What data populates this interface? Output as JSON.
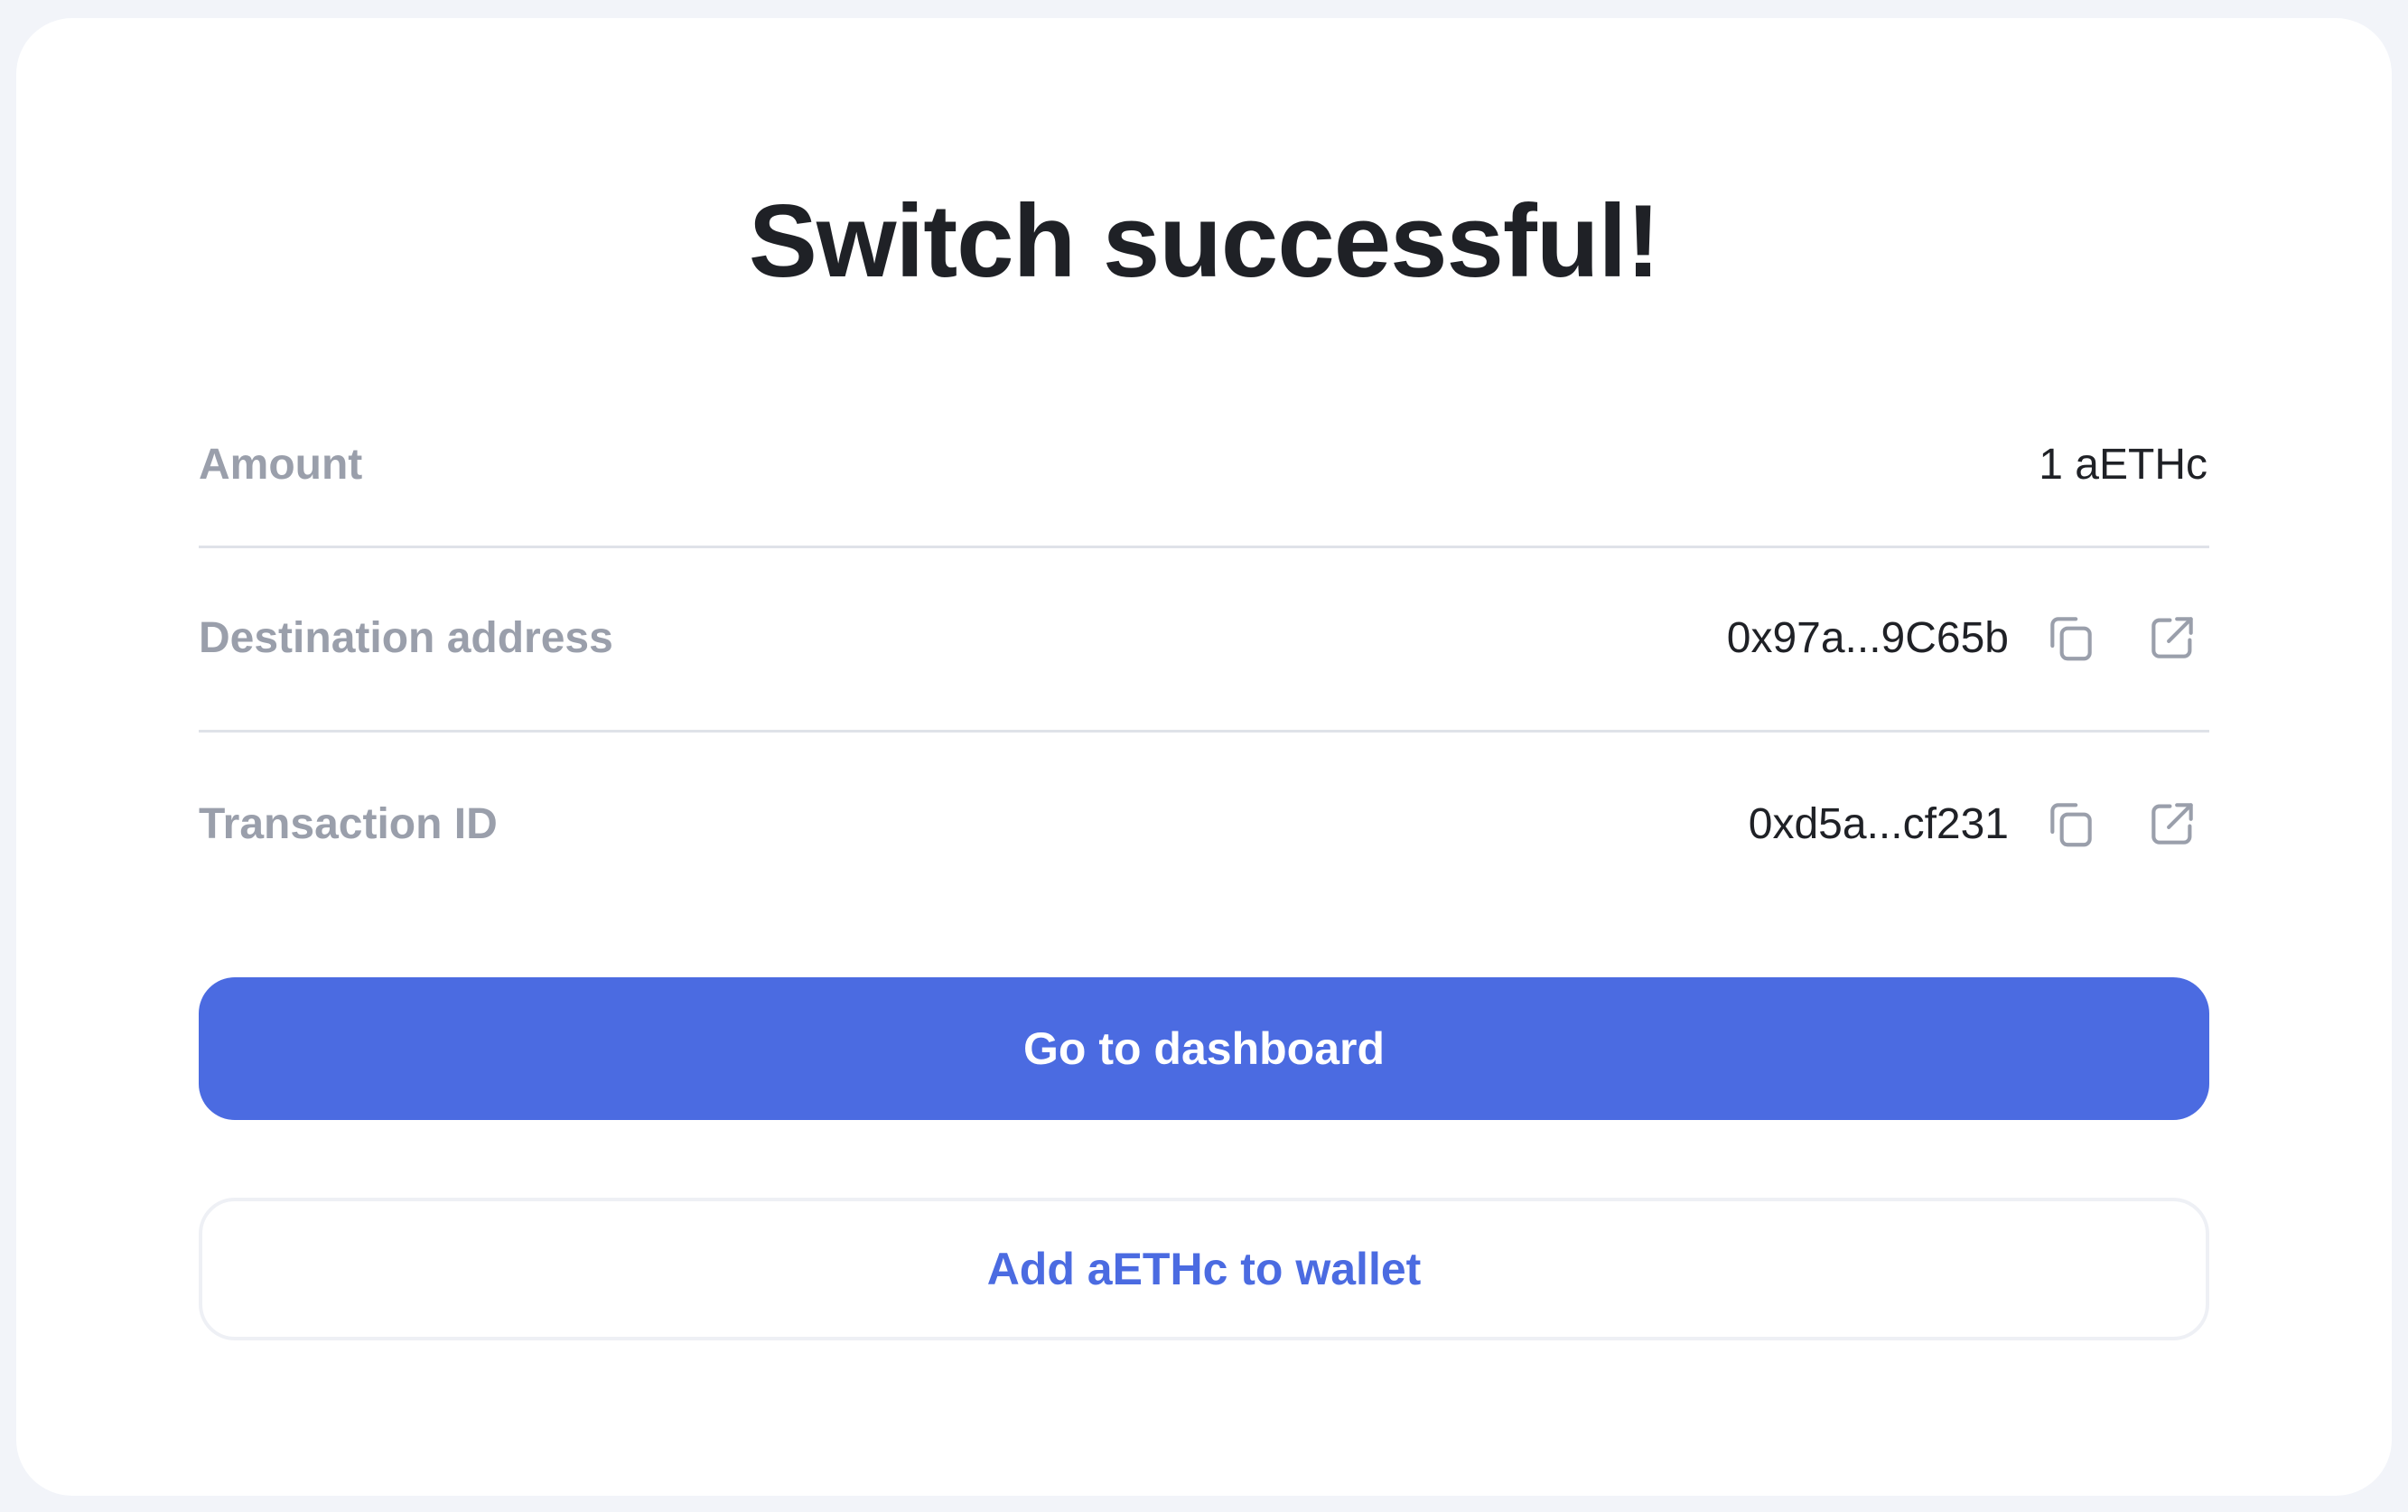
{
  "title": "Switch successful!",
  "details": {
    "amount": {
      "label": "Amount",
      "value": "1 aETHc"
    },
    "destination": {
      "label": "Destination address",
      "value": "0x97a...9C65b",
      "copy_icon": "copy-icon",
      "external_icon": "external-link-icon"
    },
    "transaction": {
      "label": "Transaction ID",
      "value": "0xd5a...cf231",
      "copy_icon": "copy-icon",
      "external_icon": "external-link-icon"
    }
  },
  "buttons": {
    "primary_label": "Go to dashboard",
    "secondary_label": "Add aETHc to wallet"
  },
  "colors": {
    "accent": "#4b6be1",
    "muted_text": "#9a9fab",
    "text": "#1f2126",
    "background": "#f2f4f9"
  }
}
